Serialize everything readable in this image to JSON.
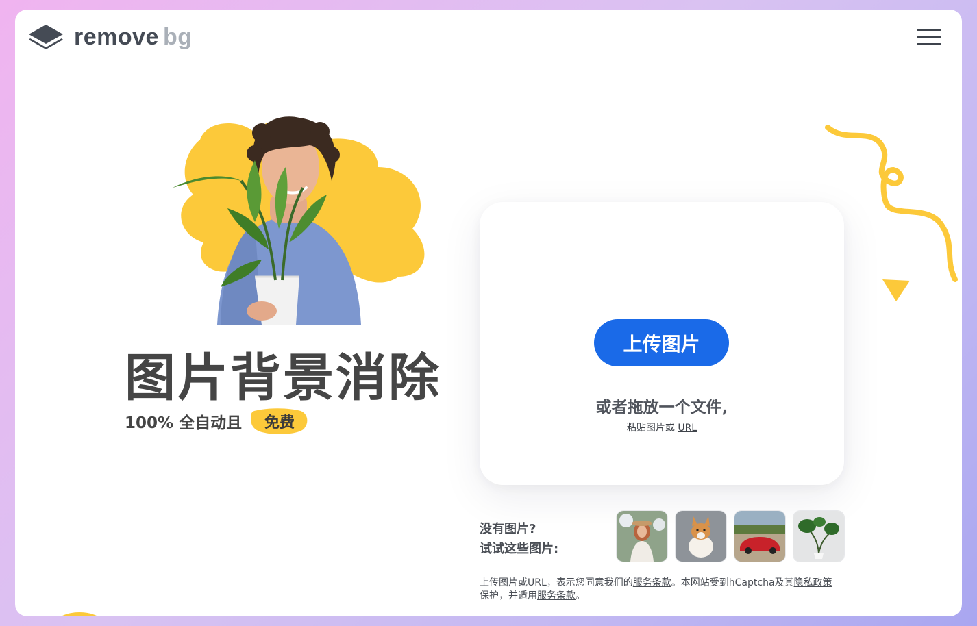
{
  "header": {
    "logo_word1": "remove",
    "logo_word2": "bg",
    "menu_icon": "hamburger-menu-icon"
  },
  "hero": {
    "title": "图片背景消除",
    "subtitle": "100% 全自动且",
    "badge": "免费"
  },
  "upload": {
    "button_label": "上传图片",
    "drop_text": "或者拖放一个文件,",
    "paste_prefix": "粘贴图片或",
    "paste_link": "URL"
  },
  "samples": {
    "line1": "没有图片?",
    "line2": "试试这些图片:",
    "items": [
      "woman-with-hat-thumbnail",
      "corgi-dog-thumbnail",
      "red-car-thumbnail",
      "monstera-plant-thumbnail"
    ]
  },
  "legal": {
    "part1": "上传图片或URL，表示您同意我们的",
    "link1": "服务条款",
    "part2": "。本网站受到hCaptcha及其",
    "link2": "隐私政策",
    "part3": "保护，并适用",
    "link3": "服务条款",
    "part4": "。"
  },
  "colors": {
    "primary": "#1a6ae8",
    "accent_yellow": "#fcc93a",
    "text_dark": "#454545"
  }
}
